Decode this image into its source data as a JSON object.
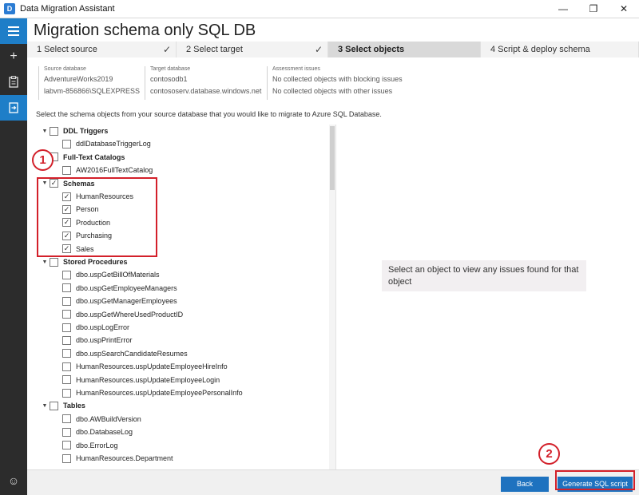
{
  "window": {
    "title": "Data Migration Assistant",
    "icon_letter": "D",
    "minimize": "—",
    "maximize": "❐",
    "close": "✕"
  },
  "rail": {
    "items": [
      "menu",
      "add",
      "assessment",
      "migration"
    ],
    "add_glyph": "+",
    "smiley_glyph": "☺"
  },
  "page": {
    "title": "Migration schema only SQL DB"
  },
  "steps": [
    {
      "label": "1   Select source",
      "done": true
    },
    {
      "label": "2   Select target",
      "done": true
    },
    {
      "label": "3   Select objects",
      "done": false
    },
    {
      "label": "4   Script & deploy schema",
      "done": false
    }
  ],
  "check_glyph": "✓",
  "info": {
    "source_label": "Source database",
    "source_db": "AdventureWorks2019",
    "source_server": "labvm-856866\\SQLEXPRESS",
    "target_label": "Target database",
    "target_db": "contosodb1",
    "target_server": "contososerv.database.windows.net",
    "issues_label": "Assessment issues",
    "issues_blocking": "No collected objects with blocking issues",
    "issues_other": "No collected objects with other issues"
  },
  "instructions": "Select the schema objects from your source database that you would like to migrate to Azure SQL Database.",
  "tree": [
    {
      "label": "DDL Triggers",
      "group": true,
      "checked": false,
      "expand": "▼"
    },
    {
      "label": "ddlDatabaseTriggerLog",
      "group": false,
      "checked": false
    },
    {
      "label": "Full-Text Catalogs",
      "group": true,
      "checked": false,
      "expand": ""
    },
    {
      "label": "AW2016FullTextCatalog",
      "group": false,
      "checked": false
    },
    {
      "label": "Schemas",
      "group": true,
      "checked": true,
      "expand": "▼"
    },
    {
      "label": "HumanResources",
      "group": false,
      "checked": true
    },
    {
      "label": "Person",
      "group": false,
      "checked": true
    },
    {
      "label": "Production",
      "group": false,
      "checked": true
    },
    {
      "label": "Purchasing",
      "group": false,
      "checked": true
    },
    {
      "label": "Sales",
      "group": false,
      "checked": true
    },
    {
      "label": "Stored Procedures",
      "group": true,
      "checked": false,
      "expand": "▼"
    },
    {
      "label": "dbo.uspGetBillOfMaterials",
      "group": false,
      "checked": false
    },
    {
      "label": "dbo.uspGetEmployeeManagers",
      "group": false,
      "checked": false
    },
    {
      "label": "dbo.uspGetManagerEmployees",
      "group": false,
      "checked": false
    },
    {
      "label": "dbo.uspGetWhereUsedProductID",
      "group": false,
      "checked": false
    },
    {
      "label": "dbo.uspLogError",
      "group": false,
      "checked": false
    },
    {
      "label": "dbo.uspPrintError",
      "group": false,
      "checked": false
    },
    {
      "label": "dbo.uspSearchCandidateResumes",
      "group": false,
      "checked": false
    },
    {
      "label": "HumanResources.uspUpdateEmployeeHireInfo",
      "group": false,
      "checked": false
    },
    {
      "label": "HumanResources.uspUpdateEmployeeLogin",
      "group": false,
      "checked": false
    },
    {
      "label": "HumanResources.uspUpdateEmployeePersonalInfo",
      "group": false,
      "checked": false
    },
    {
      "label": "Tables",
      "group": true,
      "checked": false,
      "expand": "▼"
    },
    {
      "label": "dbo.AWBuildVersion",
      "group": false,
      "checked": false
    },
    {
      "label": "dbo.DatabaseLog",
      "group": false,
      "checked": false
    },
    {
      "label": "dbo.ErrorLog",
      "group": false,
      "checked": false
    },
    {
      "label": "HumanResources.Department",
      "group": false,
      "checked": false
    }
  ],
  "detail_message": "Select an object to view any issues found for that object",
  "footer": {
    "back_label": "Back",
    "generate_label": "Generate SQL script"
  },
  "callouts": {
    "one": "1",
    "two": "2"
  },
  "colors": {
    "accent": "#1e72bf",
    "callout": "#d3202a",
    "rail": "#2c2c2c"
  }
}
